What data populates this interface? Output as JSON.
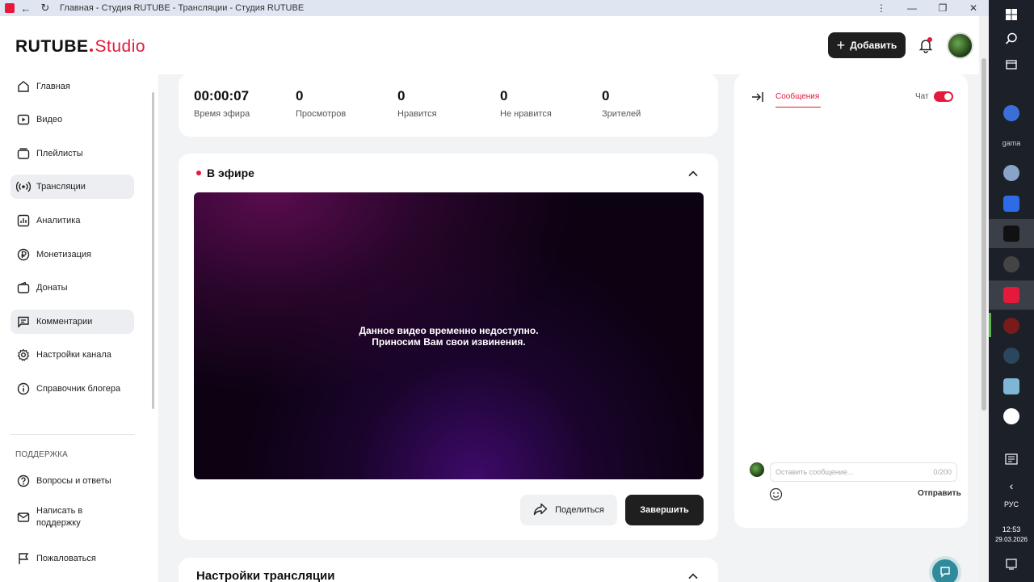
{
  "browser": {
    "tab_title": "Главная - Студия RUTUBE - Трансляции - Студия RUTUBE"
  },
  "header": {
    "logo_main": "RUTUBE",
    "logo_studio": "Studio",
    "add_label": "Добавить"
  },
  "sidebar": {
    "items": [
      {
        "label": "Главная",
        "icon": "home-icon"
      },
      {
        "label": "Видео",
        "icon": "video-icon"
      },
      {
        "label": "Плейлисты",
        "icon": "playlist-icon"
      },
      {
        "label": "Трансляции",
        "icon": "broadcast-icon"
      },
      {
        "label": "Аналитика",
        "icon": "analytics-icon"
      },
      {
        "label": "Монетизация",
        "icon": "ruble-icon"
      },
      {
        "label": "Донаты",
        "icon": "wallet-icon"
      },
      {
        "label": "Комментарии",
        "icon": "comment-icon"
      },
      {
        "label": "Настройки канала",
        "icon": "gear-icon"
      },
      {
        "label": "Справочник блогера",
        "icon": "info-icon"
      }
    ],
    "support_section": "ПОДДЕРЖКА",
    "support_items": [
      {
        "label": "Вопросы и ответы",
        "icon": "question-icon"
      },
      {
        "label": "Написать в поддержку",
        "icon": "mail-icon"
      },
      {
        "label": "Пожаловаться",
        "icon": "flag-icon"
      }
    ]
  },
  "stats": [
    {
      "value": "00:00:07",
      "label": "Время эфира"
    },
    {
      "value": "0",
      "label": "Просмотров"
    },
    {
      "value": "0",
      "label": "Нравится"
    },
    {
      "value": "0",
      "label": "Не нравится"
    },
    {
      "value": "0",
      "label": "Зрителей"
    }
  ],
  "live": {
    "title": "В эфире",
    "video_message_line1": "Данное видео временно недоступно.",
    "video_message_line2": "Приносим Вам свои извинения.",
    "share_label": "Поделиться",
    "end_label": "Завершить"
  },
  "settings": {
    "title": "Настройки трансляции"
  },
  "chat": {
    "tab_messages": "Сообщения",
    "chat_label": "Чат",
    "toggle_on": true,
    "input_placeholder": "Оставить сообщение...",
    "char_counter": "0/200",
    "send_label": "Отправить"
  },
  "taskbar": {
    "language": "РУС",
    "time": "12:53",
    "date": "29.03.2026",
    "app_label": "gama"
  },
  "colors": {
    "accent": "#e5193b",
    "dark_button": "#1f1f1f",
    "taskbar": "#1b2029"
  }
}
